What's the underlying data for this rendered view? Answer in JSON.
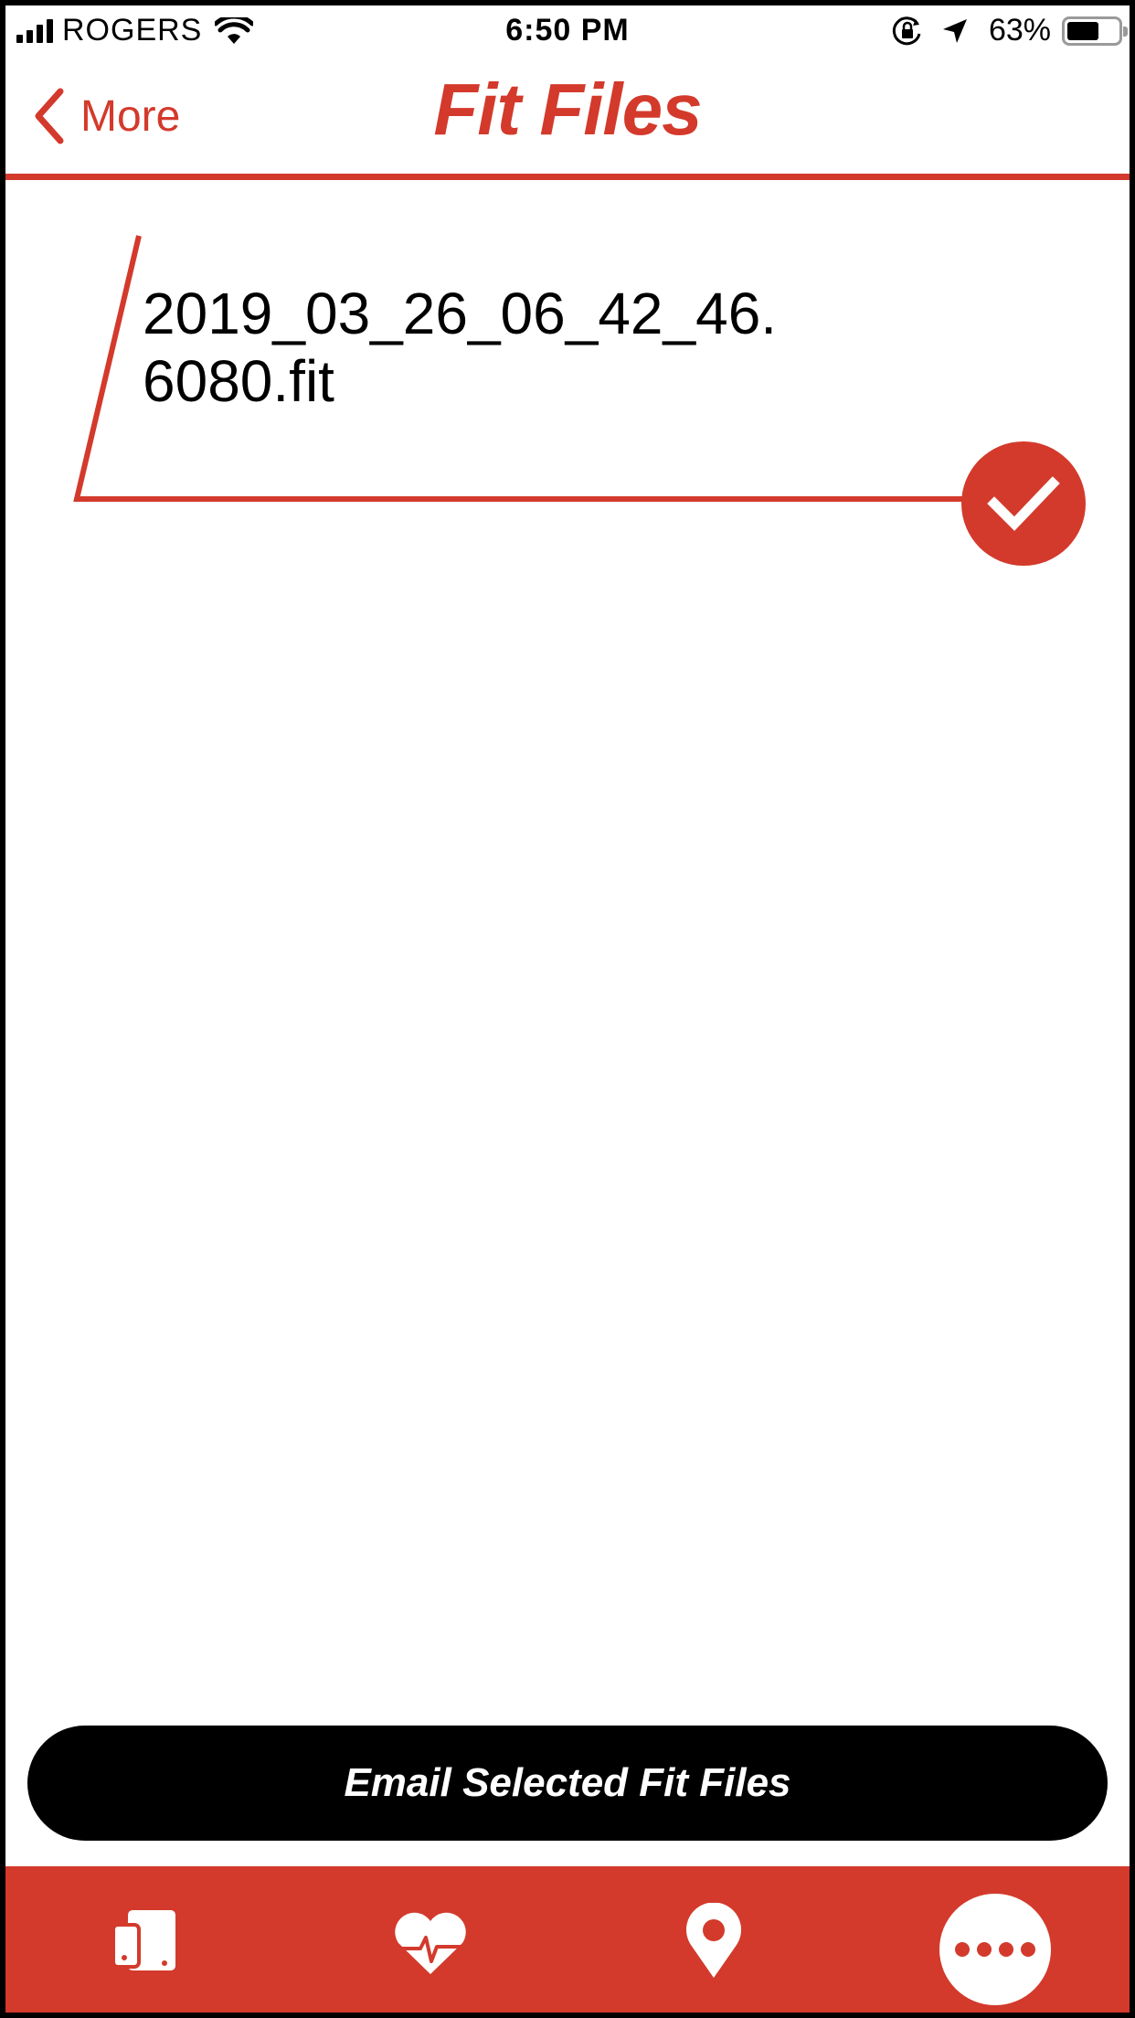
{
  "status_bar": {
    "carrier": "ROGERS",
    "time": "6:50 PM",
    "battery_percent_text": "63%",
    "battery_level": 0.63,
    "icons": [
      "signal-icon",
      "wifi-icon",
      "orientation-lock-icon",
      "location-arrow-icon",
      "battery-icon"
    ]
  },
  "nav": {
    "back_label": "More",
    "title": "Fit Files"
  },
  "files": [
    {
      "name": "2019_03_26_06_42_46.6080.fit",
      "selected": true
    }
  ],
  "actions": {
    "email_label": "Email Selected Fit Files"
  },
  "tab_bar": {
    "tabs": [
      {
        "icon": "devices-icon",
        "active": false
      },
      {
        "icon": "heart-rate-icon",
        "active": false
      },
      {
        "icon": "map-pin-icon",
        "active": false
      },
      {
        "icon": "more-dots-icon",
        "active": true
      }
    ]
  },
  "colors": {
    "accent": "#d33a2c",
    "background": "#ffffff",
    "button": "#000000"
  }
}
